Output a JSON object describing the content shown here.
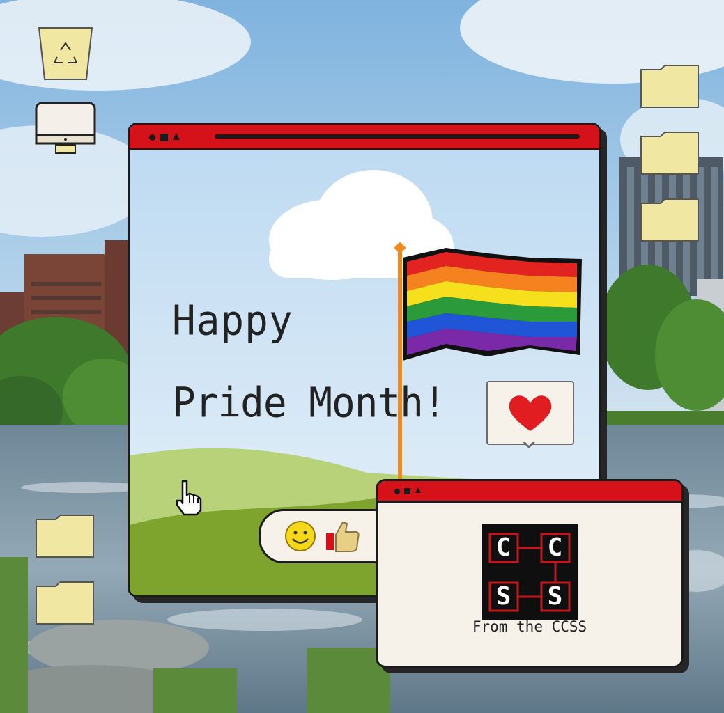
{
  "desktop": {
    "icons": [
      {
        "name": "recycle-bin",
        "icon": "recycle-icon"
      },
      {
        "name": "my-computer",
        "icon": "monitor-icon"
      },
      {
        "name": "folder-1",
        "icon": "folder-icon"
      },
      {
        "name": "folder-2",
        "icon": "folder-icon"
      },
      {
        "name": "folder-3",
        "icon": "folder-icon"
      },
      {
        "name": "folder-4",
        "icon": "folder-icon"
      },
      {
        "name": "folder-5",
        "icon": "folder-icon"
      }
    ]
  },
  "main_window": {
    "line1": "Happy",
    "line2": "Pride Month!",
    "reactions": [
      "smiley-icon",
      "thumbs-up-icon"
    ],
    "heart": "heart-icon"
  },
  "logo_window": {
    "logo_letters": [
      "C",
      "C",
      "S",
      "S"
    ],
    "caption": "From the CCSS"
  },
  "colors": {
    "titlebar": "#d5121a",
    "folder": "#f0e7a3",
    "window_bg": "#f6f2ea",
    "heart": "#e21d22",
    "flag": [
      "#e2231f",
      "#f5821f",
      "#f6e01d",
      "#2b9a3b",
      "#1f55d6",
      "#7a2aa8"
    ]
  }
}
